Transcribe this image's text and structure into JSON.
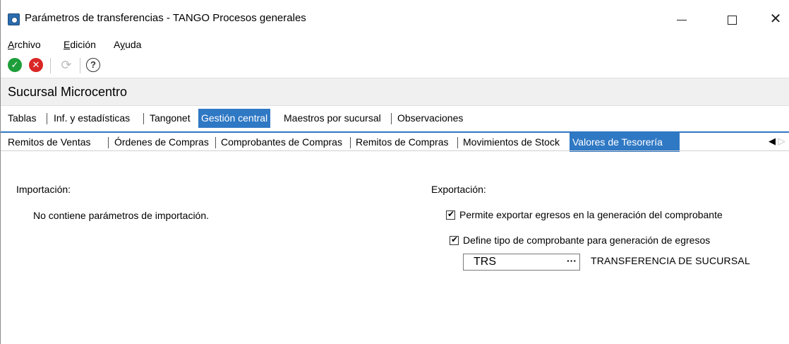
{
  "window": {
    "title": "Parámetros de transferencias - TANGO Procesos generales",
    "minimize_glyph": "—",
    "maximize_glyph": "☐",
    "close_glyph": "✕"
  },
  "menu": {
    "items": [
      {
        "label": "Archivo",
        "accel": "A",
        "rest": "rchivo"
      },
      {
        "label": "Edición",
        "accel": "E",
        "rest": "dición"
      },
      {
        "label": "Ayuda",
        "pre": "A",
        "accel": "y",
        "rest": "uda"
      }
    ]
  },
  "toolbar": {
    "ok_icon": "check-circle-icon",
    "cancel_icon": "x-circle-icon",
    "refresh_icon": "refresh-icon",
    "help_icon": "help-icon",
    "ok_glyph": "✓",
    "cancel_glyph": "✕",
    "refresh_glyph": "⟳",
    "help_glyph": "?"
  },
  "branch": {
    "label": "Sucursal Microcentro"
  },
  "tabs_primary": [
    {
      "label": "Tablas",
      "active": false
    },
    {
      "label": "Inf. y estadísticas",
      "active": false
    },
    {
      "label": "Tangonet",
      "active": false
    },
    {
      "label": "Gestión central",
      "active": true
    },
    {
      "label": "Maestros por sucursal",
      "active": false
    },
    {
      "label": "Observaciones",
      "active": false
    }
  ],
  "tabs_secondary": [
    {
      "label": "Remitos de Ventas",
      "active": false
    },
    {
      "label": "Órdenes de Compras",
      "active": false
    },
    {
      "label": "Comprobantes de Compras",
      "active": false
    },
    {
      "label": "Remitos de Compras",
      "active": false
    },
    {
      "label": "Movimientos de Stock",
      "active": false
    },
    {
      "label": "Valores de Tesorería",
      "active": true
    }
  ],
  "tab_scroll": {
    "left": "◀",
    "right": "▷"
  },
  "import_section": {
    "title": "Importación:",
    "message": "No contiene parámetros de importación."
  },
  "export_section": {
    "title": "Exportación:",
    "allow_export": {
      "label": "Permite exportar egresos en la generación del comprobante",
      "checked": true
    },
    "define_type": {
      "label": "Define tipo de comprobante para generación de egresos",
      "checked": true
    },
    "voucher_code": "TRS",
    "browse_glyph": "···",
    "voucher_description": "TRANSFERENCIA  DE SUCURSAL"
  },
  "colors": {
    "active_tab": "#2f78c4",
    "ok": "#1e9e3a",
    "cancel": "#d92626",
    "branch_bg": "#f0f0f0"
  }
}
